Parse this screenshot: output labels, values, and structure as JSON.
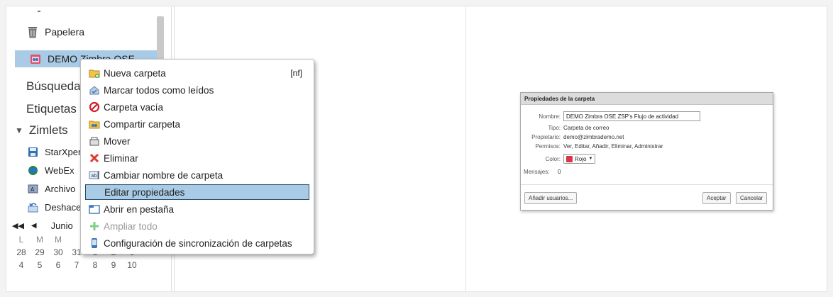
{
  "tree": {
    "items": [
      {
        "label": "Papelera",
        "icon": "trash-icon"
      },
      {
        "label": "DEMO Zimbra OSE",
        "icon": "shared-calendar-icon"
      },
      {
        "label": "Búsquedas"
      },
      {
        "label": "Etiquetas"
      },
      {
        "label": "Zimlets"
      },
      {
        "label": "StarXpert",
        "icon": "floppy-icon"
      },
      {
        "label": "WebEx",
        "icon": "globe-icon"
      },
      {
        "label": "Archivo",
        "icon": "archive-icon"
      },
      {
        "label": "Deshacer",
        "icon": "undo-icon"
      }
    ]
  },
  "calendar": {
    "month": "Junio",
    "weekdays": [
      "L",
      "M",
      "M",
      "",
      "",
      "",
      ""
    ],
    "rows": [
      [
        "28",
        "29",
        "30",
        "31",
        "1",
        "2",
        "3"
      ],
      [
        "4",
        "5",
        "6",
        "7",
        "8",
        "9",
        "10"
      ]
    ]
  },
  "context_menu": {
    "items": [
      {
        "label": "Nueva carpeta",
        "shortcut": "[nf]",
        "icon": "new-folder-icon"
      },
      {
        "label": "Marcar todos como leídos",
        "icon": "mark-read-icon"
      },
      {
        "label": "Carpeta vacía",
        "icon": "empty-folder-icon"
      },
      {
        "label": "Compartir carpeta",
        "icon": "share-folder-icon"
      },
      {
        "label": "Mover",
        "icon": "move-icon"
      },
      {
        "label": "Eliminar",
        "icon": "delete-icon"
      },
      {
        "label": "Cambiar nombre de carpeta",
        "icon": "rename-icon"
      },
      {
        "label": "Editar propiedades",
        "icon": ""
      },
      {
        "label": "Abrir en pestaña",
        "icon": "open-tab-icon"
      },
      {
        "label": "Ampliar todo",
        "icon": "expand-all-icon"
      },
      {
        "label": "Configuración de sincronización de carpetas",
        "icon": "sync-icon"
      }
    ]
  },
  "dialog": {
    "title": "Propiedades de la carpeta",
    "name_label": "Nombre:",
    "name_value": "DEMO Zimbra OSE ZSP's Flujo de actividad",
    "type_label": "Tipo:",
    "type_value": "Carpeta de correo",
    "owner_label": "Propietario:",
    "owner_value": "demo@zimbrademo.net",
    "perms_label": "Permisos:",
    "perms_value": "Ver, Editar, Añadir, Eliminar, Administrar",
    "color_label": "Color:",
    "color_value": "Rojo",
    "messages_label": "Mensajes:",
    "messages_value": "0",
    "add_users_button": "Añadir usuarios...",
    "ok_button": "Aceptar",
    "cancel_button": "Cancelar"
  },
  "colors": {
    "selection": "#a9cbe6",
    "selection_border": "#2c4d6b",
    "red_color_swatch": "#d9364a"
  }
}
